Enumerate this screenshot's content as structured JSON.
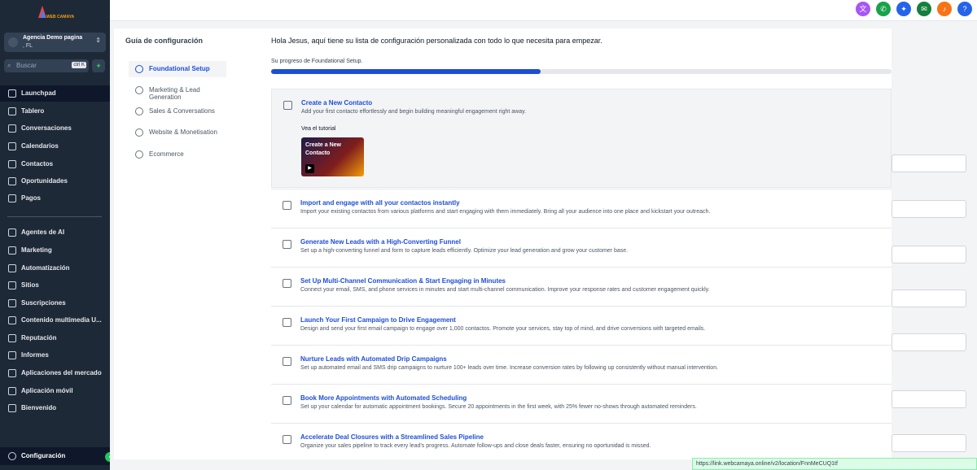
{
  "logo": {
    "text": "WEB CAMAYA"
  },
  "account": {
    "name": "Agencia Demo pagina",
    "location": ", FL"
  },
  "search": {
    "placeholder": "Buscar",
    "shortcut": "ctrl K"
  },
  "sidebar": {
    "items": [
      {
        "label": "Launchpad"
      },
      {
        "label": "Tablero"
      },
      {
        "label": "Conversaciones"
      },
      {
        "label": "Calendarios"
      },
      {
        "label": "Contactos"
      },
      {
        "label": "Oportunidades"
      },
      {
        "label": "Pagos"
      },
      {
        "label": "Agentes de AI"
      },
      {
        "label": "Marketing"
      },
      {
        "label": "Automatización"
      },
      {
        "label": "Sitios"
      },
      {
        "label": "Suscripciones"
      },
      {
        "label": "Contenido multimedia U..."
      },
      {
        "label": "Reputación"
      },
      {
        "label": "Informes"
      },
      {
        "label": "Aplicaciones del mercado"
      },
      {
        "label": "Aplicación móvil"
      },
      {
        "label": "Bienvenido"
      }
    ],
    "settings_label": "Configuración"
  },
  "topbar": {
    "icons": [
      "translate-icon",
      "phone-icon",
      "magic-icon",
      "megaphone-icon",
      "bell-icon",
      "help-icon"
    ],
    "icon_glyphs": [
      "文",
      "✆",
      "✦",
      "✉",
      "♪",
      "?"
    ],
    "colors": [
      "#a855f7",
      "#16a34a",
      "#2563eb",
      "#15803d",
      "#f97316",
      "#2563eb"
    ]
  },
  "guide": {
    "title": "Guía de configuración",
    "nav": [
      {
        "label": "Foundational Setup"
      },
      {
        "label": "Marketing & Lead Generation"
      },
      {
        "label": "Sales & Conversations"
      },
      {
        "label": "Website & Monetisation"
      },
      {
        "label": "Ecommerce"
      }
    ],
    "greeting": "Hola Jesus, aquí tiene su lista de configuración personalizada con todo lo que necesita para empezar.",
    "progress_label": "Su progreso de Foundational Setup.",
    "progress": 0.435,
    "tutorial_label": "Vea el tutorial",
    "tutorial_thumb": "Create a New Contacto",
    "tasks": [
      {
        "title": "Create a New Contacto",
        "desc": "Add your first contacto effortlessly and begin building meaningful engagement right away."
      },
      {
        "title": "Import and engage with all your contactos instantly",
        "desc": "Import your existing contactos from various platforms and start engaging with them immediately. Bring all your audience into one place and kickstart your outreach."
      },
      {
        "title": "Generate New Leads with a High-Converting Funnel",
        "desc": "Set up a high-converting funnel and form to capture leads efficiently. Optimize your lead generation and grow your customer base."
      },
      {
        "title": "Set Up Multi-Channel Communication & Start Engaging in Minutes",
        "desc": "Connect your email, SMS, and phone services in minutes and start multi-channel communication. Improve your response rates and customer engagement quickly."
      },
      {
        "title": "Launch Your First Campaign to Drive Engagement",
        "desc": "Design and send your first email campaign to engage over 1,000 contactos. Promote your services, stay top of mind, and drive conversions with targeted emails."
      },
      {
        "title": "Nurture Leads with Automated Drip Campaigns",
        "desc": "Set up automated email and SMS drip campaigns to nurture 100+ leads over time. Increase conversion rates by following up consistently without manual intervention."
      },
      {
        "title": "Book More Appointments with Automated Scheduling",
        "desc": "Set up your calendar for automatic appointment bookings. Secure 20 appointments in the first week, with 25% fewer no-shows through automated reminders."
      },
      {
        "title": "Accelerate Deal Closures with a Streamlined Sales Pipeline",
        "desc": "Organize your sales pipeline to track every lead's progress. Automate follow-ups and close deals faster, ensuring no oportunidad is missed."
      }
    ]
  },
  "status_url": "https://link.webcamaya.online/v2/location/FnnMeCUQ1tf"
}
